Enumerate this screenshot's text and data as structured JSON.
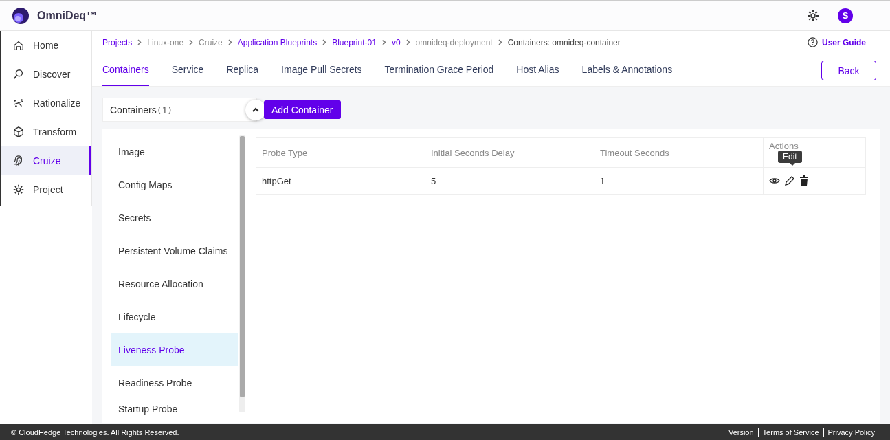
{
  "app": {
    "name": "OmniDeq™",
    "avatar": "S"
  },
  "sidebar": {
    "items": [
      {
        "label": "Home",
        "selected": false
      },
      {
        "label": "Discover",
        "selected": false
      },
      {
        "label": "Rationalize",
        "selected": false
      },
      {
        "label": "Transform",
        "selected": false
      },
      {
        "label": "Cruize",
        "selected": true
      },
      {
        "label": "Project",
        "selected": false
      }
    ]
  },
  "breadcrumb": [
    {
      "label": "Projects",
      "link": true
    },
    {
      "label": "Linux-one",
      "link": false
    },
    {
      "label": "Cruize",
      "link": false
    },
    {
      "label": "Application Blueprints",
      "link": true
    },
    {
      "label": "Blueprint-01",
      "link": true
    },
    {
      "label": "v0",
      "link": true
    },
    {
      "label": "omnideq-deployment",
      "link": false
    },
    {
      "label": "Containers: omnideq-container",
      "link": false,
      "current": true
    }
  ],
  "user_guide": "User Guide",
  "tabs": [
    {
      "label": "Containers",
      "selected": true
    },
    {
      "label": "Service",
      "selected": false
    },
    {
      "label": "Replica",
      "selected": false
    },
    {
      "label": "Image Pull Secrets",
      "selected": false
    },
    {
      "label": "Termination Grace Period",
      "selected": false
    },
    {
      "label": "Host Alias",
      "selected": false
    },
    {
      "label": "Labels & Annotations",
      "selected": false
    }
  ],
  "back_button": "Back",
  "containers": {
    "label": "Containers",
    "count": "(1)",
    "expanded": true
  },
  "add_button": "Add Container",
  "sections": [
    {
      "label": "Image",
      "selected": false
    },
    {
      "label": "Config Maps",
      "selected": false
    },
    {
      "label": "Secrets",
      "selected": false
    },
    {
      "label": "Persistent Volume Claims",
      "selected": false
    },
    {
      "label": "Resource Allocation",
      "selected": false
    },
    {
      "label": "Lifecycle",
      "selected": false
    },
    {
      "label": "Liveness Probe",
      "selected": true
    },
    {
      "label": "Readiness Probe",
      "selected": false
    },
    {
      "label": "Startup Probe",
      "selected": false
    }
  ],
  "table": {
    "columns": [
      "Probe Type",
      "Initial Seconds Delay",
      "Timeout Seconds",
      "Actions"
    ],
    "rows": [
      [
        "httpGet",
        "5",
        "1"
      ]
    ]
  },
  "tooltip": "Edit",
  "footer": {
    "copyright": "© CloudHedge Technologies. All Rights Reserved.",
    "links": [
      "Version",
      "Terms of Service",
      "Privacy Policy"
    ]
  }
}
